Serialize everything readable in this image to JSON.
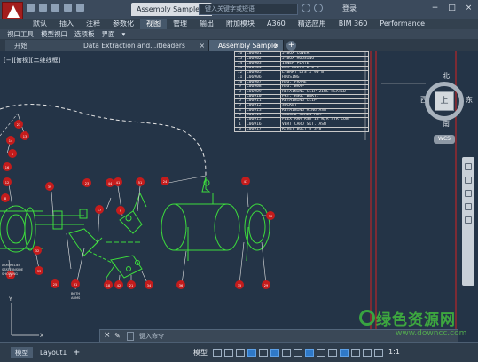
{
  "window": {
    "title_tab": "Assembly Sample...",
    "search_placeholder": "键入关键字或短语",
    "login": "登录",
    "controls": [
      "−",
      "□",
      "×"
    ]
  },
  "ribbon": {
    "tabs": [
      "默认",
      "插入",
      "注释",
      "参数化",
      "视图",
      "管理",
      "输出",
      "附加模块",
      "A360",
      "精选应用",
      "BIM 360",
      "Performance"
    ],
    "active": "视图"
  },
  "panels": [
    "视口工具",
    "模型视口",
    "选项板",
    "界面",
    "▾"
  ],
  "doc_tabs": {
    "start": "开始",
    "doc1": "Data Extraction and...itleaders Sample*",
    "doc2": "Assembly Sample",
    "close": "×",
    "add": "+"
  },
  "viewport": {
    "label": "[−][俯视][二维线框]"
  },
  "bom_rows": [
    [
      "16",
      "C06901",
      "J-BOX COVER"
    ],
    [
      "15",
      "C06902",
      "J-BOX HOUSING"
    ],
    [
      "14",
      "C06903",
      "INNER PLATE"
    ],
    [
      "13",
      "C06904",
      "WIR BOLTS B 0 B"
    ],
    [
      "12",
      "C06905",
      "L-BRKT LTS X 90 B"
    ],
    [
      "11",
      "C06906",
      "HOUSING"
    ],
    [
      "10",
      "C06907",
      "HSG. FRAME"
    ],
    [
      "9",
      "C06908",
      "HSG. WRAP"
    ],
    [
      "8",
      "C06909",
      "RETAINING CLIP ZINC PLATED"
    ],
    [
      "7",
      "C06910",
      "PKT. HSG. BRKT."
    ],
    [
      "6",
      "C06911",
      "RETAINING CLIP"
    ],
    [
      "5",
      "C06912",
      "SOCKET"
    ],
    [
      "4",
      "C06913",
      "RETAINING RING ASM"
    ],
    [
      "3",
      "C06914",
      "GROUND SCREW ASM"
    ],
    [
      "2",
      "C06915",
      "FLEX ARM ASM 18 W/A STR CON"
    ],
    [
      "1",
      "C06916",
      "VERT CARD SKT. ASM"
    ],
    [
      "0",
      "C06917",
      "RIVET BOLT B 3/8"
    ]
  ],
  "viewcube": {
    "north": "北",
    "south": "南",
    "west": "西",
    "east": "东",
    "top": "上",
    "wcs": "WCS"
  },
  "drawing_text": {
    "nums": [
      "13",
      "14",
      "1",
      "16",
      "12",
      "39",
      "23",
      "44",
      "41",
      "51",
      "24",
      "47",
      "8",
      "17",
      "9",
      "19",
      "32",
      "33",
      "25",
      "31",
      "18",
      "42",
      "21",
      "34",
      "36",
      "35",
      "29",
      "30",
      "3",
      "7",
      "28",
      "2",
      "23"
    ],
    "notes": [
      "ASM RELIEF",
      "STATE INSIDE",
      "SHOWING",
      "BOTH",
      "ARMS"
    ]
  },
  "command": {
    "close": "×",
    "tool": "✎",
    "placeholder": "键入命令"
  },
  "status": {
    "tab_model": "模型",
    "tab_layout": "Layout1",
    "add": "+",
    "model": "模型",
    "scale": "1:1"
  },
  "watermark": {
    "cn": "绿色资源网",
    "url": "www.downcc.com"
  },
  "colors": {
    "background": "#243447",
    "geometry": "#3ddc3d",
    "balloon": "#d32222",
    "line": "#e6e6e6"
  }
}
